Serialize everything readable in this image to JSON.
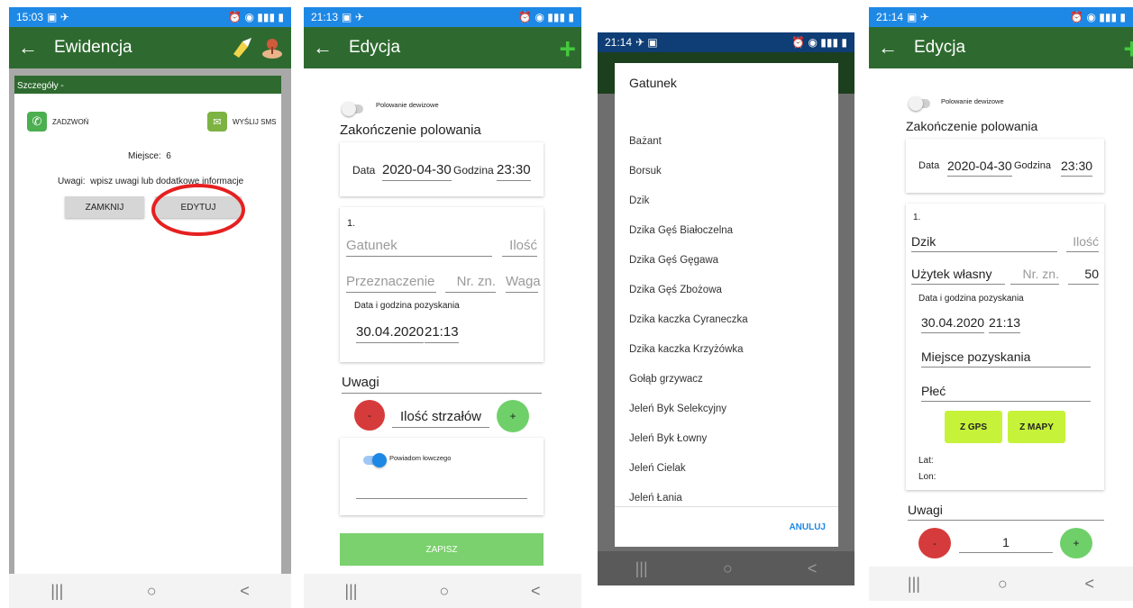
{
  "screen1": {
    "status_time": "15:03",
    "title": "Ewidencja",
    "panel_header": "Szczegóły -",
    "call_label": "ZADZWOŃ",
    "sms_label": "WYŚLIJ SMS",
    "place_label": "Miejsce:",
    "place_value": "6",
    "notes_label": "Uwagi:",
    "notes_value": "wpisz uwagi lub dodatkowe informacje",
    "close_button": "ZAMKNIJ",
    "edit_button": "EDYTUJ"
  },
  "screen2": {
    "status_time": "21:13",
    "title": "Edycja",
    "toggle_label": "Polowanie dewizowe",
    "section_title": "Zakończenie polowania",
    "date_label": "Data",
    "date_value": "2020-04-30",
    "hour_label": "Godzina",
    "hour_value": "23:30",
    "item_number": "1.",
    "species_placeholder": "Gatunek",
    "qty_placeholder": "Ilość",
    "purpose_placeholder": "Przeznaczenie",
    "tag_placeholder": "Nr. zn.",
    "weight_placeholder": "Waga",
    "acq_label": "Data i godzina pozyskania",
    "acq_date": "30.04.2020",
    "acq_time": "21:13",
    "notes_placeholder": "Uwagi",
    "minus": "-",
    "shots_placeholder": "Ilość strzałów",
    "plus": "+",
    "notify_label": "Powiadom łowczego",
    "save_button": "ZAPISZ"
  },
  "screen3": {
    "status_time": "21:14",
    "dialog_title": "Gatunek",
    "items": [
      "Bażant",
      "Borsuk",
      "Dzik",
      "Dzika Gęś Białoczelna",
      "Dzika Gęś Gęgawa",
      "Dzika Gęś Zbożowa",
      "Dzika kaczka Cyraneczka",
      "Dzika kaczka Krzyżówka",
      "Gołąb grzywacz",
      "Jeleń Byk Selekcyjny",
      "Jeleń Byk Łowny",
      "Jeleń Cielak",
      "Jeleń Łania"
    ],
    "cancel_button": "ANULUJ"
  },
  "screen4": {
    "status_time": "21:14",
    "title": "Edycja",
    "toggle_label": "Polowanie dewizowe",
    "section_title": "Zakończenie polowania",
    "date_label": "Data",
    "date_value": "2020-04-30",
    "hour_label": "Godzina",
    "hour_value": "23:30",
    "item_number": "1.",
    "species_value": "Dzik",
    "qty_placeholder": "Ilość",
    "purpose_value": "Użytek własny",
    "tag_placeholder": "Nr. zn.",
    "weight_value": "50",
    "acq_label": "Data i godzina pozyskania",
    "acq_date": "30.04.2020",
    "acq_time": "21:13",
    "place_value": "Miejsce pozyskania",
    "sex_value": "Płeć",
    "gps_button": "Z GPS",
    "map_button": "Z MAPY",
    "lat_label": "Lat:",
    "lon_label": "Lon:",
    "notes_value": "Uwagi",
    "minus": "-",
    "shots_value": "1",
    "plus": "+"
  },
  "nav": {
    "recent": "|||",
    "home": "○",
    "back": "<"
  },
  "colors": {
    "appbar": "#2e6a2f",
    "statusbar": "#1e88e5",
    "accent_green": "#44c93f",
    "minus_red": "#d63b3b",
    "plus_green": "#6fd06a",
    "save_green": "#7ad16d",
    "gps_yellow": "#c6f23a"
  }
}
